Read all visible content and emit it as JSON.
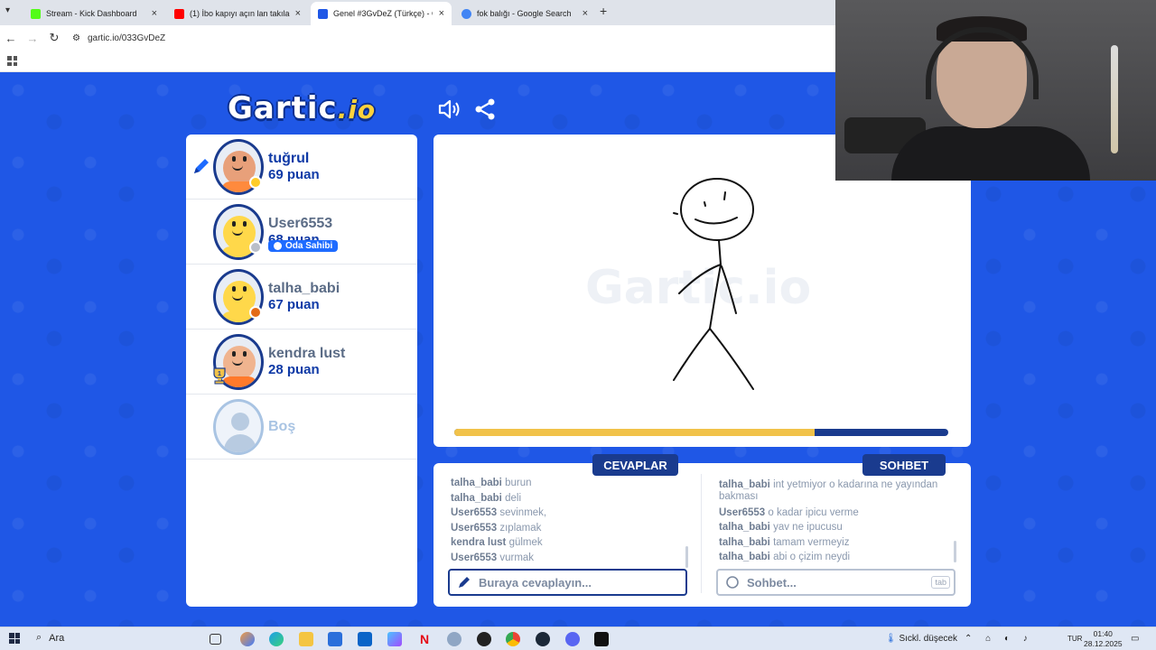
{
  "browser": {
    "tabs": [
      {
        "title": "Stream - Kick Dashboard",
        "favicon_color": "#53fc18",
        "active": false
      },
      {
        "title": "(1) İbo kapıyı açın lan takılacaz",
        "favicon_color": "#ff0000",
        "active": false
      },
      {
        "title": "Genel #3GvDeZ (Türkçe) - Gartic",
        "favicon_color": "#1f57e6",
        "active": true
      },
      {
        "title": "fok balığı - Google Search",
        "favicon_color": "#4285f4",
        "active": false
      }
    ],
    "url": "gartic.io/033GvDeZ",
    "new_tab_symbol": "+",
    "close_symbol": "×"
  },
  "game": {
    "logo_main": "Gartic",
    "logo_suffix": ".io",
    "sound_icon": "speaker-icon",
    "share_icon": "share-icon",
    "players": [
      {
        "name": "tuğrul",
        "score": "69 puan",
        "drawing": true,
        "skin": "#e8a07a",
        "shirt": "#ff8a3d",
        "dot": "#ffcc29"
      },
      {
        "name": "User6553",
        "score": "68 puan",
        "owner": true,
        "skin": "#ffd84a",
        "shirt": "#ffd84a",
        "dot": "#b9bec8"
      },
      {
        "name": "talha_babi",
        "score": "67 puan",
        "skin": "#ffd84a",
        "shirt": "#ffd84a",
        "dot": "#e36b17"
      },
      {
        "name": "kendra lust",
        "score": "28 puan",
        "trophy": "1",
        "skin": "#f0b48f",
        "shirt": "#ff7a2b",
        "dot": ""
      }
    ],
    "owner_badge": "Oda Sahibi",
    "empty_slot": "Boş",
    "watermark": "Gartic.io",
    "timer_progress": 0.73,
    "colors": {
      "brand_blue": "#1f57e6",
      "navy": "#1a3b8e",
      "timer_gold": "#f1c24a"
    }
  },
  "answers": {
    "tab_label": "CEVAPLAR",
    "messages": [
      {
        "user": "talha_babi",
        "text": "burun"
      },
      {
        "user": "talha_babi",
        "text": "deli"
      },
      {
        "user": "User6553",
        "text": "sevinmek,"
      },
      {
        "user": "User6553",
        "text": "zıplamak"
      },
      {
        "user": "kendra lust",
        "text": "gülmek"
      },
      {
        "user": "User6553",
        "text": "vurmak"
      }
    ],
    "placeholder": "Buraya cevaplayın..."
  },
  "chat": {
    "tab_label": "SOHBET",
    "messages": [
      {
        "user": "talha_babi",
        "text": "int yetmiyor o kadarına ne yayından bakması"
      },
      {
        "user": "User6553",
        "text": "o kadar ipicu verme"
      },
      {
        "user": "talha_babi",
        "text": "yav ne ipucusu"
      },
      {
        "user": "talha_babi",
        "text": "tamam vermeyiz"
      },
      {
        "user": "talha_babi",
        "text": "abi o çizim neydi"
      }
    ],
    "placeholder": "Sohbet...",
    "tab_hint": "tab"
  },
  "taskbar": {
    "search_label": "Ara",
    "weather": "Sıckl. düşecek",
    "language": "TUR",
    "time": "01:40",
    "date": "28.12.2025",
    "apps": [
      "explorer-icon",
      "edge-icon",
      "folder-icon",
      "store-icon",
      "outlook-icon",
      "copilot-icon",
      "netflix-icon",
      "settings-icon",
      "obs-icon",
      "chrome-icon",
      "steam-icon",
      "discord-icon",
      "epic-icon"
    ]
  }
}
